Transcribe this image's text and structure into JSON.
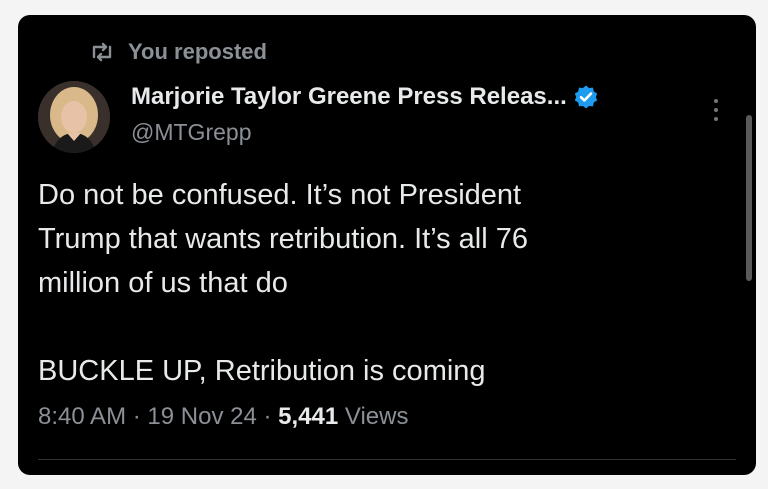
{
  "repost": {
    "label": "You reposted",
    "icon": "repost-icon"
  },
  "author": {
    "name": "Marjorie Taylor Greene Press Releas...",
    "handle": "@MTGrepp",
    "verified": true,
    "verified_color": "#1d9bf0"
  },
  "tweet": {
    "lines": [
      "Do not be confused. It’s not President",
      "Trump that wants retribution. It’s all 76",
      "million of us that do",
      "BUCKLE UP, Retribution is coming"
    ]
  },
  "meta": {
    "time": "8:40 AM",
    "separator": "·",
    "date": "19 Nov 24",
    "views_count": "5,441",
    "views_label": "Views"
  },
  "colors": {
    "background": "#000000",
    "text_primary": "#e7e9ea",
    "text_secondary": "#8b9096"
  }
}
